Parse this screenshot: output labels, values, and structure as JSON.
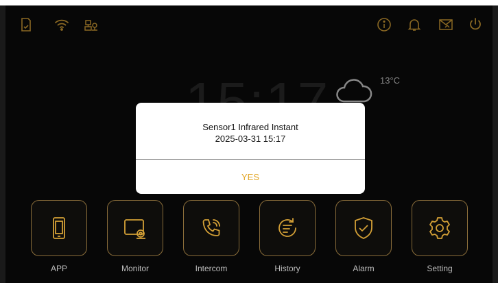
{
  "colors": {
    "accent": "#d4a036",
    "background": "#0c0c0c",
    "dialog_button": "#e2a523"
  },
  "status_bar": {
    "left_icons": [
      "sd-card-icon",
      "wifi-icon",
      "network-camera-icon"
    ],
    "right_icons": [
      "info-icon",
      "bell-icon",
      "message-icon",
      "power-icon"
    ]
  },
  "home": {
    "time": "15:17",
    "weather_icon": "cloud-icon",
    "temperature": "13°C"
  },
  "dialog": {
    "message_line1": "Sensor1 Infrared Instant",
    "message_line2": "2025-03-31 15:17",
    "yes_label": "YES"
  },
  "apps": [
    {
      "label": "APP",
      "icon": "phone-icon"
    },
    {
      "label": "Monitor",
      "icon": "monitor-icon"
    },
    {
      "label": "Intercom",
      "icon": "intercom-icon"
    },
    {
      "label": "History",
      "icon": "history-icon"
    },
    {
      "label": "Alarm",
      "icon": "alarm-shield-icon"
    },
    {
      "label": "Setting",
      "icon": "setting-gear-icon"
    }
  ]
}
